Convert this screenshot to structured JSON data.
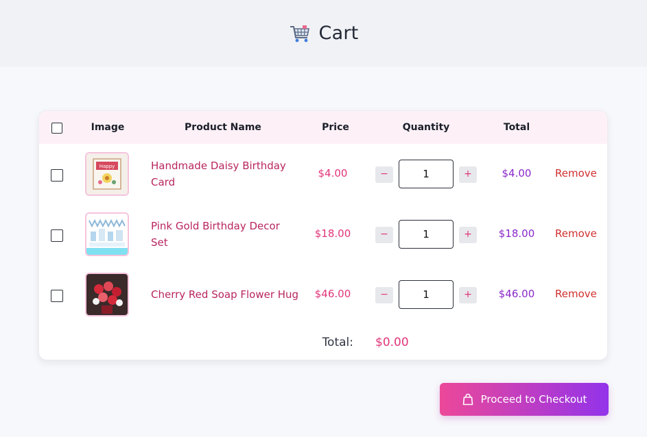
{
  "header": {
    "title": "Cart",
    "icon": "shopping-cart-icon"
  },
  "table": {
    "columns": {
      "image": "Image",
      "product_name": "Product Name",
      "price": "Price",
      "quantity": "Quantity",
      "total": "Total"
    },
    "items": [
      {
        "name_line1": "Handmade Daisy Birthday",
        "name_line2": "Card",
        "price": "$4.00",
        "quantity": "1",
        "total": "$4.00",
        "remove_label": "Remove",
        "decrement": "−",
        "increment": "+",
        "image": "birthday-card-thumbnail"
      },
      {
        "name_line1": "Pink Gold Birthday Decor",
        "name_line2": "Set",
        "price": "$18.00",
        "quantity": "1",
        "total": "$18.00",
        "remove_label": "Remove",
        "decrement": "−",
        "increment": "+",
        "image": "decor-set-thumbnail"
      },
      {
        "name_line1": "Cherry Red Soap Flower Hug",
        "name_line2": "",
        "price": "$46.00",
        "quantity": "1",
        "total": "$46.00",
        "remove_label": "Remove",
        "decrement": "−",
        "increment": "+",
        "image": "soap-flower-thumbnail"
      }
    ],
    "footer": {
      "total_label": "Total:",
      "total_value": "$0.00"
    }
  },
  "checkout": {
    "label": "Proceed to Checkout",
    "icon": "shopping-bag-icon"
  },
  "colors": {
    "accent_pink": "#e0357a",
    "accent_purple": "#8a28c9",
    "remove_red": "#d02f2f",
    "gradient_start": "#ec4899",
    "gradient_end": "#9333ea"
  }
}
